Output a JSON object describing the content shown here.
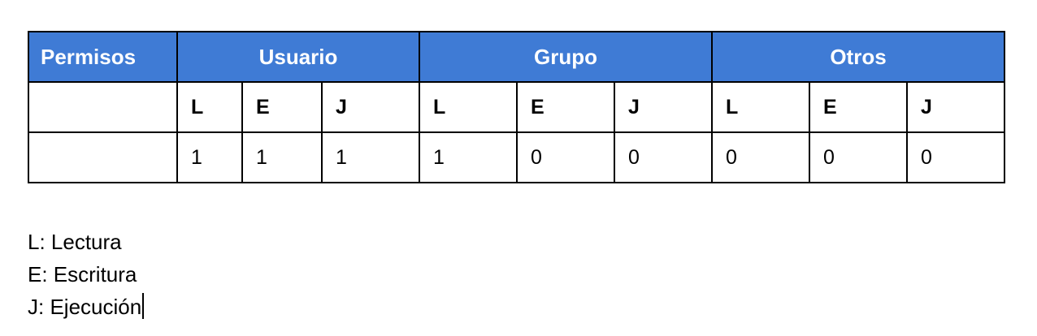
{
  "table": {
    "header": {
      "permisos": "Permisos",
      "usuario": "Usuario",
      "grupo": "Grupo",
      "otros": "Otros"
    },
    "subheaders": [
      "L",
      "E",
      "J",
      "L",
      "E",
      "J",
      "L",
      "E",
      "J"
    ],
    "values": [
      "1",
      "1",
      "1",
      "1",
      "0",
      "0",
      "0",
      "0",
      "0"
    ]
  },
  "legend": [
    "L: Lectura",
    "E: Escritura",
    "J: Ejecución"
  ]
}
